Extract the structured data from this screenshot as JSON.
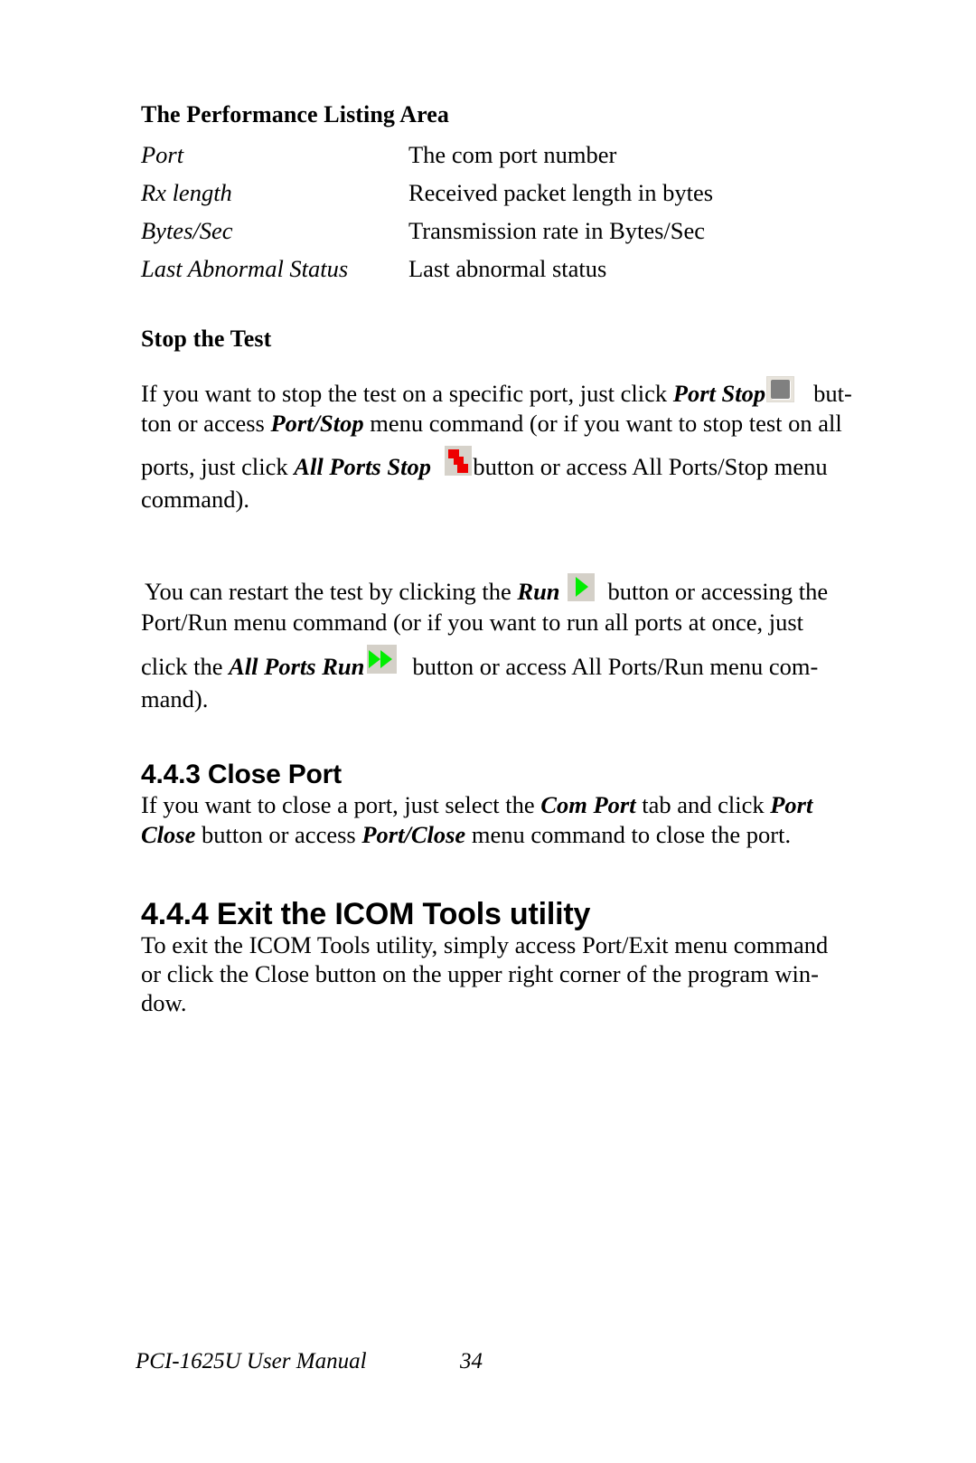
{
  "document": {
    "footer_left": "PCI-1625U User Manual",
    "page_number": "34"
  },
  "performance_section": {
    "heading": "The Performance Listing Area",
    "definitions": [
      {
        "term": "Port",
        "description": "The com port number"
      },
      {
        "term": "Rx length",
        "description": "Received packet length in bytes"
      },
      {
        "term": "Bytes/Sec",
        "description": "Transmission rate in Bytes/Sec"
      },
      {
        "term": "Last Abnormal Status",
        "description": "Last abnormal status"
      }
    ]
  },
  "stop_test_section": {
    "heading": "Stop the Test",
    "paragraph1": {
      "line1_a": "If you want to stop the test on a specific port, just click ",
      "line1_term": "Port Stop",
      "line1_b": " but-",
      "line2_a": "ton or access ",
      "line2_term": "Port/Stop",
      "line2_b": " menu command (or if you want to stop test on all",
      "line3_a": "ports, just click ",
      "line3_term": "All Ports Stop",
      "line3_b": "button or access All Ports/Stop menu",
      "line4": "command)."
    },
    "paragraph2": {
      "line1_a": "You can restart the test by clicking the ",
      "line1_term": "Run",
      "line1_b": " button or accessing the",
      "line2": "Port/Run menu command (or if you want to run all ports at once, just",
      "line3_a": "click the ",
      "line3_term": "All Ports Run",
      "line3_b": " button or access All Ports/Run menu com-",
      "line4": "mand)."
    },
    "icons": {
      "port_stop": "port-stop-icon",
      "all_ports_stop": "all-ports-stop-icon",
      "run": "run-icon",
      "all_ports_run": "all-ports-run-icon"
    }
  },
  "close_port_section": {
    "heading": "4.4.3 Close Port",
    "line1_a": "If you want to close a port, just select the ",
    "line1_term1": "Com Port",
    "line1_b": " tab and click ",
    "line1_term2": "Port",
    "line2_term1": "Close",
    "line2_a": " button or access ",
    "line2_term2": "Port/Close",
    "line2_b": " menu command to close the port."
  },
  "exit_section": {
    "heading": "4.4.4 Exit the ICOM Tools utility",
    "line1": "To exit the ICOM Tools utility, simply access Port/Exit menu command",
    "line2": "or click the Close button on the upper right corner of the program win-",
    "line3": "dow."
  },
  "colors": {
    "stop_red": "#ee0000",
    "run_green": "#00ee00",
    "button_face": "#d4d0c8",
    "stop_gray": "#808080"
  }
}
